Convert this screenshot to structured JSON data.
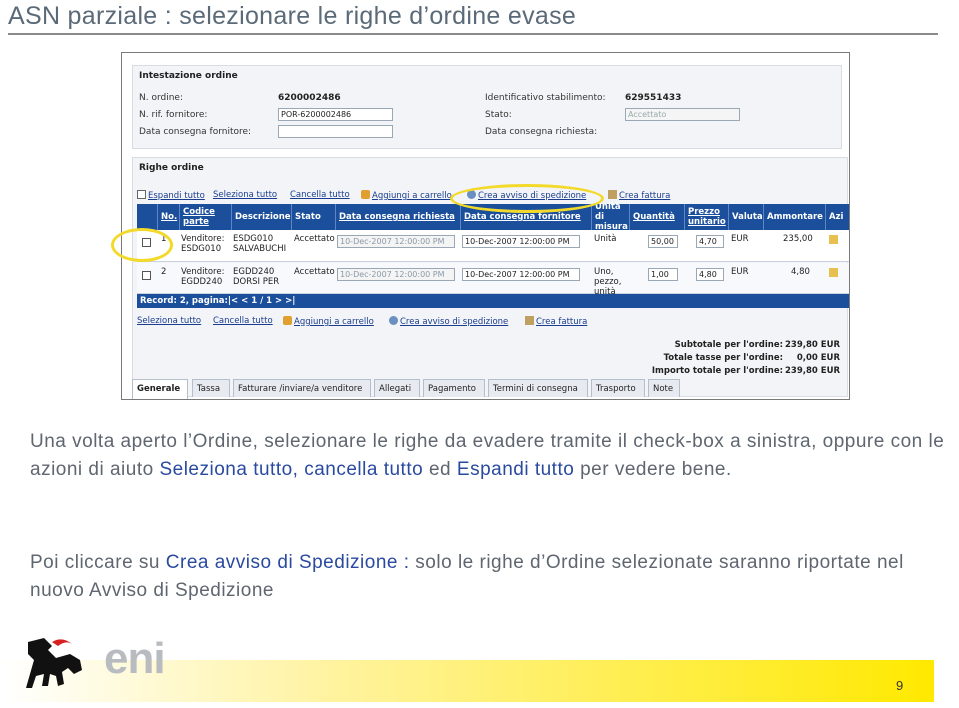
{
  "slide": {
    "title": "ASN parziale : selezionare le righe d’ordine evase",
    "page_number": "9",
    "logo_text": "eni"
  },
  "header_panel": {
    "title": "Intestazione ordine",
    "order_no_label": "N. ordine:",
    "order_no": "6200002486",
    "supplier_ref_label": "N. rif. fornitore:",
    "supplier_ref": "POR-6200002486",
    "ship_date_label": "Data consegna fornitore:",
    "site_id_label": "Identificativo stabilimento:",
    "site_id": "629551433",
    "state_label": "Stato:",
    "state_value": "Accettato",
    "req_date_label": "Data consegna richiesta:"
  },
  "lines_panel": {
    "title": "Righe ordine",
    "toolbar": {
      "expand_all": "Espandi tutto",
      "select_all": "Seleziona tutto",
      "clear_all": "Cancella tutto",
      "add_to_cart": "Aggiungi a carrello",
      "create_asn": "Crea avviso di spedizione",
      "create_invoice": "Crea fattura"
    },
    "columns": {
      "no": "No.",
      "part_code": "Codice parte",
      "description": "Descrizione",
      "state": "Stato",
      "req_date": "Data consegna richiesta",
      "supplier_date": "Data consegna fornitore",
      "uom": "Unità di misura",
      "qty": "Quantità",
      "unit_price": "Prezzo unitario",
      "currency": "Valuta",
      "amount": "Ammontare",
      "actions": "Azi"
    },
    "rows": [
      {
        "no": "1",
        "part_code": "Venditore: ESDG010",
        "description": "ESDG010 SALVABUCHI",
        "state": "Accettato",
        "req_date": "10-Dec-2007 12:00:00 PM",
        "supplier_date": "10-Dec-2007 12:00:00 PM",
        "uom": "Unità",
        "qty": "50,00",
        "unit_price": "4,70",
        "currency": "EUR",
        "amount": "235,00"
      },
      {
        "no": "2",
        "part_code": "Venditore: EGDD240",
        "description": "EGDD240 DORSI PER",
        "state": "Accettato",
        "req_date": "10-Dec-2007 12:00:00 PM",
        "supplier_date": "10-Dec-2007 12:00:00 PM",
        "uom": "Uno, pezzo, unità",
        "qty": "1,00",
        "unit_price": "4,80",
        "currency": "EUR",
        "amount": "4,80"
      }
    ],
    "record_bar": "Record: 2, pagina:|< < 1 / 1 > >|",
    "totals": {
      "subtotal_label": "Subtotale per l'ordine:",
      "subtotal": "239,80 EUR",
      "tax_label": "Totale tasse per l'ordine:",
      "tax": "0,00 EUR",
      "total_label": "Importo totale per l'ordine:",
      "total": "239,80 EUR"
    },
    "tabs": [
      "Generale",
      "Tassa",
      "Fatturare /inviare/a venditore",
      "Allegati",
      "Pagamento",
      "Termini di consegna",
      "Trasporto",
      "Note"
    ]
  },
  "highlight_color": "#f3da2a",
  "body_text": {
    "p1_a": "Una volta aperto l’Ordine,  selezionare le righe da evadere tramite il check-box a sinistra, oppure con le azioni di aiuto ",
    "p1_link": "Seleziona tutto, cancella tutto",
    "p1_b": " ed ",
    "p1_link2": "Espandi tutto",
    "p1_c": " per vedere bene.",
    "p2_a": "Poi cliccare su ",
    "p2_link": "Crea avviso di Spedizione :",
    "p2_b": " solo le righe d’Ordine selezionate saranno riportate nel nuovo Avviso di Spedizione"
  }
}
